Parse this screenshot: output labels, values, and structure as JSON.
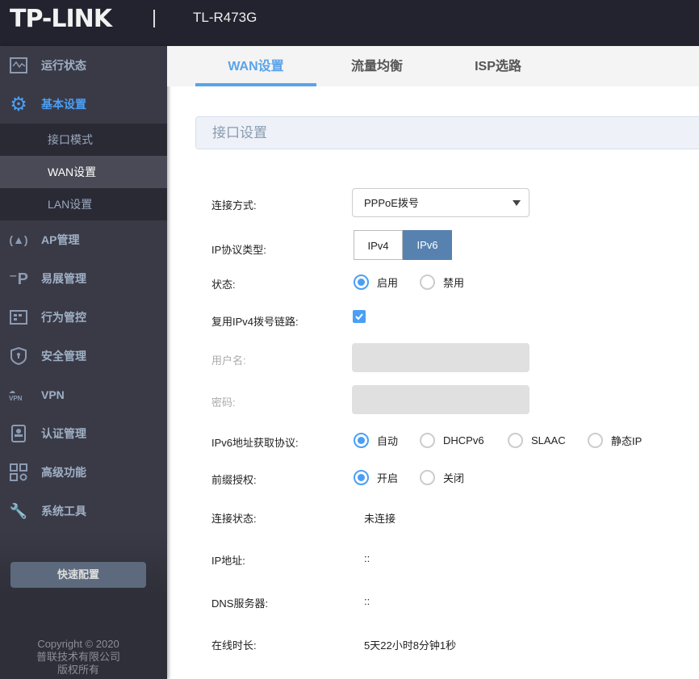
{
  "header": {
    "logo": "TP-LINK",
    "model": "TL-R473G"
  },
  "sidebar": {
    "items": [
      {
        "label": "运行状态",
        "icon": "monitor-icon"
      },
      {
        "label": "基本设置",
        "icon": "gear-icon"
      },
      {
        "label": "AP管理",
        "icon": "ap-antenna-icon"
      },
      {
        "label": "易展管理",
        "icon": "easy-expand-icon"
      },
      {
        "label": "行为管控",
        "icon": "behavior-control-icon"
      },
      {
        "label": "安全管理",
        "icon": "shield-icon"
      },
      {
        "label": "VPN",
        "icon": "vpn-cloud-icon"
      },
      {
        "label": "认证管理",
        "icon": "auth-user-icon"
      },
      {
        "label": "高级功能",
        "icon": "advanced-grid-icon"
      },
      {
        "label": "系统工具",
        "icon": "tools-icon"
      }
    ],
    "sub": [
      "接口模式",
      "WAN设置",
      "LAN设置"
    ],
    "quick": "快速配置",
    "copyright": [
      "Copyright © 2020",
      "普联技术有限公司",
      "版权所有"
    ]
  },
  "tabs": [
    "WAN设置",
    "流量均衡",
    "ISP选路"
  ],
  "section": "接口设置",
  "form": {
    "conn_label": "连接方式:",
    "conn_value": "PPPoE拨号",
    "proto_label": "IP协议类型:",
    "proto_opts": [
      "IPv4",
      "IPv6"
    ],
    "status_label": "状态:",
    "status_opts": [
      "启用",
      "禁用"
    ],
    "reuse_label": "复用IPv4拨号链路:",
    "user_label": "用户名:",
    "pwd_label": "密码:",
    "v6_label": "IPv6地址获取协议:",
    "v6_opts": [
      "自动",
      "DHCPv6",
      "SLAAC",
      "静态IP"
    ],
    "prefix_label": "前缀授权:",
    "prefix_opts": [
      "开启",
      "关闭"
    ],
    "cs_label": "连接状态:",
    "cs_value": "未连接",
    "ip_label": "IP地址:",
    "ip_value": "::",
    "dns_label": "DNS服务器:",
    "dns_value": "::",
    "ol_label": "在线时长:",
    "ol_value": "5天22小时8分钟1秒"
  }
}
